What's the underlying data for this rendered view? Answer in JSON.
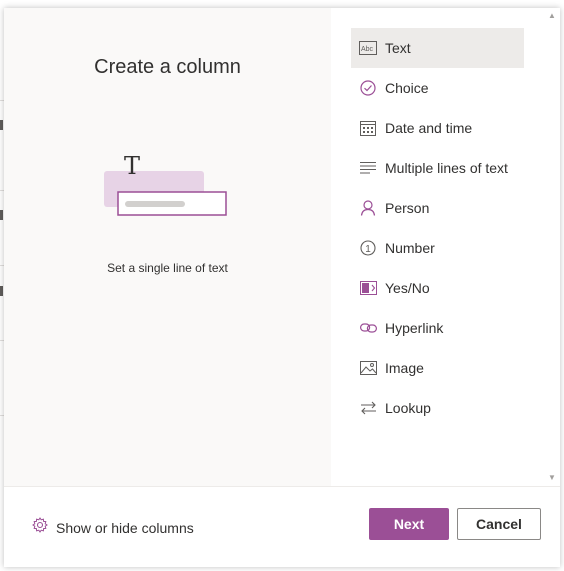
{
  "dialog": {
    "title": "Create a column",
    "description": "Set a single line of text"
  },
  "column_types": [
    {
      "label": "Text",
      "icon": "text-field-icon",
      "selected": true
    },
    {
      "label": "Choice",
      "icon": "choice-check-icon",
      "selected": false
    },
    {
      "label": "Date and time",
      "icon": "calendar-icon",
      "selected": false
    },
    {
      "label": "Multiple lines of text",
      "icon": "multiline-text-icon",
      "selected": false
    },
    {
      "label": "Person",
      "icon": "person-icon",
      "selected": false
    },
    {
      "label": "Number",
      "icon": "number-icon",
      "selected": false
    },
    {
      "label": "Yes/No",
      "icon": "yes-no-icon",
      "selected": false
    },
    {
      "label": "Hyperlink",
      "icon": "link-icon",
      "selected": false
    },
    {
      "label": "Image",
      "icon": "image-icon",
      "selected": false
    },
    {
      "label": "Lookup",
      "icon": "lookup-icon",
      "selected": false
    }
  ],
  "footer": {
    "show_hide_label": "Show or hide columns",
    "next_label": "Next",
    "cancel_label": "Cancel"
  },
  "colors": {
    "accent": "#9b4f96",
    "selected_bg": "#edebe9",
    "left_pane_bg": "#faf9f8"
  }
}
